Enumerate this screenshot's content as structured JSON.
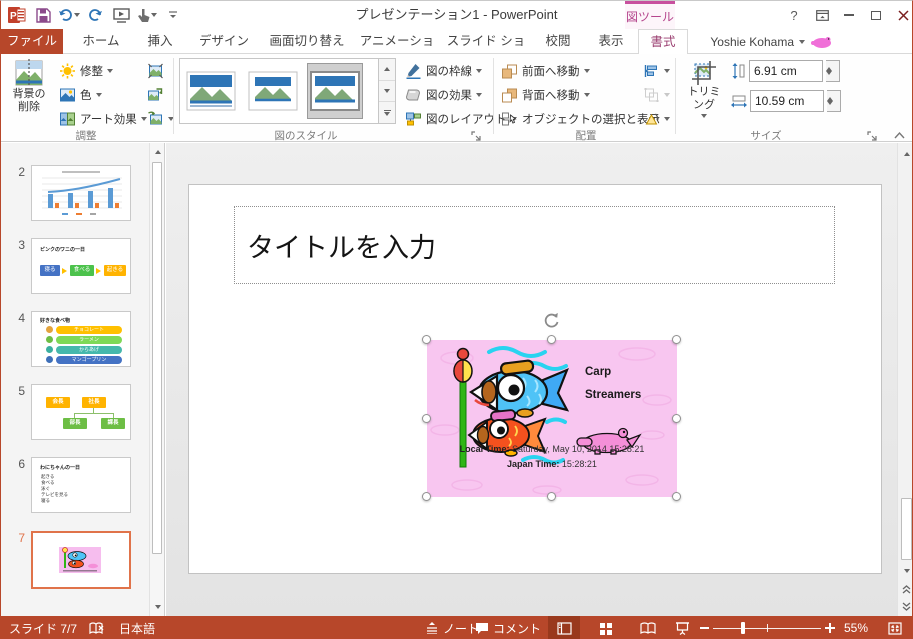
{
  "titlebar": {
    "title": "プレゼンテーション1 - PowerPoint",
    "contextual_tool_label": "図ツール",
    "help_label": "?",
    "account_name": "Yoshie Kohama"
  },
  "tabs": {
    "file": "ファイル",
    "home": "ホーム",
    "insert": "挿入",
    "design": "デザイン",
    "transitions": "画面切り替え",
    "animations": "アニメーション",
    "slideshow": "スライド ショー",
    "review": "校閲",
    "view": "表示",
    "format": "書式"
  },
  "ribbon": {
    "adjust": {
      "remove_background_line1": "背景の",
      "remove_background_line2": "削除",
      "corrections": "修整",
      "color": "色",
      "artistic_effects": "アート効果",
      "group_label": "調整"
    },
    "picture_styles": {
      "picture_border": "図の枠線",
      "picture_effects": "図の効果",
      "picture_layout": "図のレイアウト",
      "group_label": "図のスタイル"
    },
    "arrange": {
      "bring_forward": "前面へ移動",
      "send_backward": "背面へ移動",
      "selection_pane": "オブジェクトの選択と表示",
      "group_label": "配置"
    },
    "size": {
      "crop": "トリミング",
      "height_value": "6.91 cm",
      "width_value": "10.59 cm",
      "group_label": "サイズ"
    }
  },
  "thumbnails": {
    "slide2": {
      "number": "2"
    },
    "slide3": {
      "number": "3",
      "title": "ピンクのワニの一日",
      "steps": [
        "寝る",
        "食べる",
        "起きる"
      ]
    },
    "slide4": {
      "number": "4",
      "title": "好きな食べ物",
      "items": [
        "チョコレート",
        "ラーメン",
        "からあげ",
        "マンゴープリン"
      ]
    },
    "slide5": {
      "number": "5",
      "top": [
        "会長",
        "社長"
      ],
      "bottom": [
        "部長",
        "課長"
      ]
    },
    "slide6": {
      "number": "6",
      "title": "わにちゃんの一日",
      "bullets": [
        "起きる",
        "食べる",
        "泳ぐ",
        "テレビを見る",
        "寝る"
      ]
    },
    "slide7": {
      "number": "7"
    }
  },
  "slide": {
    "title_placeholder": "タイトルを入力",
    "picture": {
      "caption_line1": "Carp",
      "caption_line2": "Streamers",
      "local_time_label": "Local Time:",
      "local_time_value": "Saturday, May 10, 2014 15:28:21",
      "japan_time_label": "Japan Time:",
      "japan_time_value": "15:28:21"
    }
  },
  "statusbar": {
    "slide_indicator": "スライド 7/7",
    "language": "日本語",
    "notes": "ノート",
    "comments": "コメント",
    "zoom_percent": "55%"
  },
  "colors": {
    "accent_red": "#B7472A",
    "contextual_magenta": "#C8509E",
    "selection_orange": "#E0734A"
  }
}
